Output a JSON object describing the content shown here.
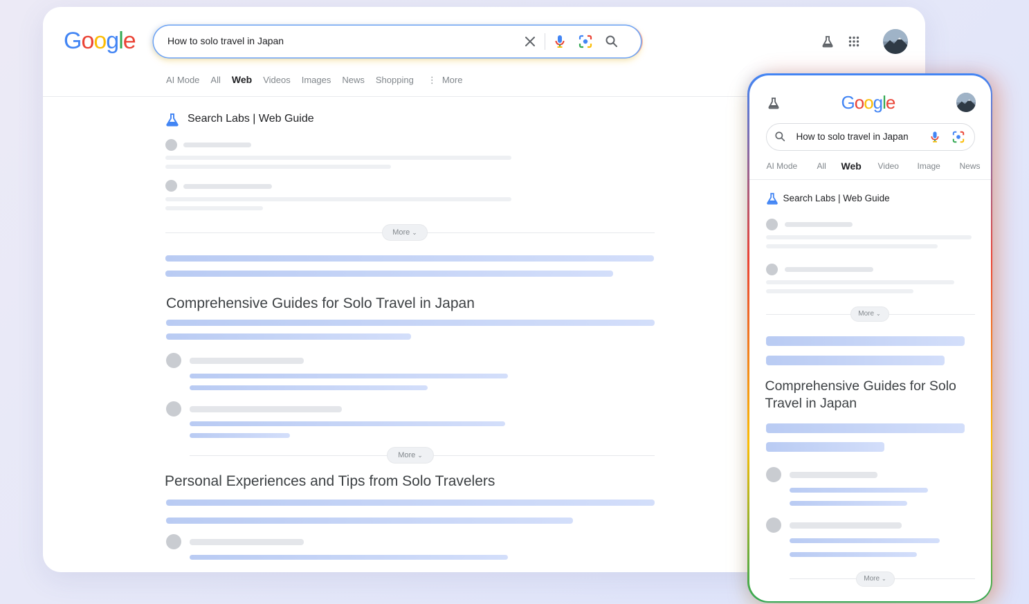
{
  "desktop": {
    "logo_letters": [
      "G",
      "o",
      "o",
      "g",
      "l",
      "e"
    ],
    "search": {
      "query": "How to solo travel in Japan"
    },
    "tabs": [
      "AI Mode",
      "All",
      "Web",
      "Videos",
      "Images",
      "News",
      "Shopping",
      "More"
    ],
    "active_tab": "Web",
    "labs_title": "Search Labs | Web Guide",
    "more_label": "More",
    "section_1_title": "Comprehensive Guides for Solo Travel in Japan",
    "section_2_title": "Personal Experiences and Tips from Solo Travelers"
  },
  "mobile": {
    "search": {
      "query": "How to solo travel in Japan"
    },
    "tabs": [
      "AI Mode",
      "All",
      "Web",
      "Video",
      "Image",
      "News"
    ],
    "active_tab": "Web",
    "labs_title": "Search Labs | Web Guide",
    "more_label": "More",
    "section_1_title": "Comprehensive Guides for Solo Travel in Japan"
  },
  "icons": {
    "close": "close-icon",
    "mic": "mic-icon",
    "lens": "lens-icon",
    "search": "search-icon",
    "labs": "labs-flask-icon",
    "apps": "apps-grid-icon",
    "avatar": "avatar"
  },
  "colors": {
    "google_blue": "#4285f4",
    "google_red": "#ea4335",
    "google_yellow": "#fbbc05",
    "google_green": "#34a853"
  }
}
